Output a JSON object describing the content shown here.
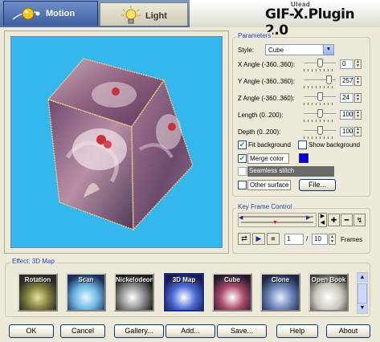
{
  "tabs": [
    {
      "label": "Motion",
      "active": true
    },
    {
      "label": "Light",
      "active": false
    }
  ],
  "brand": {
    "company": "Ulead",
    "title": "GIF-X.Plugin 2.0"
  },
  "preview": {
    "image_alt": "3D rotating cube preview"
  },
  "parameters": {
    "title": "Parameters",
    "style_label": "Style:",
    "style_value": "Cube",
    "sliders": [
      {
        "label": "X Angle (-360..360):",
        "value": "0",
        "fraction": 0.5
      },
      {
        "label": "Y Angle (-360..360):",
        "value": "257",
        "fraction": 0.86
      },
      {
        "label": "Z Angle (-360..360):",
        "value": "24",
        "fraction": 0.53
      },
      {
        "label": "Length (0..200):",
        "value": "100",
        "fraction": 0.5
      },
      {
        "label": "Depth (0..200):",
        "value": "100",
        "fraction": 0.5
      }
    ],
    "fit_background": {
      "label": "Fit background",
      "checked": true
    },
    "show_background": {
      "label": "Show background",
      "checked": false
    },
    "merge_color": {
      "label": "Merge color",
      "checked": true,
      "color": "#0000ee"
    },
    "seamless_stitch": {
      "label": "Seamless stitch",
      "checked": false
    },
    "other_surface": {
      "label": "Other surface",
      "checked": false
    },
    "file_button": "File..."
  },
  "keyframe": {
    "title": "Key Frame Control",
    "current_frame": "1",
    "separator": "/",
    "total_frames": "10",
    "frames_label": "Frames"
  },
  "effects": {
    "title": "Effect: 3D Map",
    "items": [
      {
        "name": "Rotation",
        "selected": false
      },
      {
        "name": "Scan",
        "selected": false
      },
      {
        "name": "Nickelodeon",
        "selected": false
      },
      {
        "name": "3D Map",
        "selected": true
      },
      {
        "name": "Cube",
        "selected": false
      },
      {
        "name": "Clone",
        "selected": false
      },
      {
        "name": "Open Book",
        "selected": false
      }
    ]
  },
  "buttons": {
    "ok": "OK",
    "cancel": "Cancel",
    "gallery": "Gallery...",
    "add": "Add...",
    "save": "Save...",
    "help": "Help",
    "about": "About"
  }
}
